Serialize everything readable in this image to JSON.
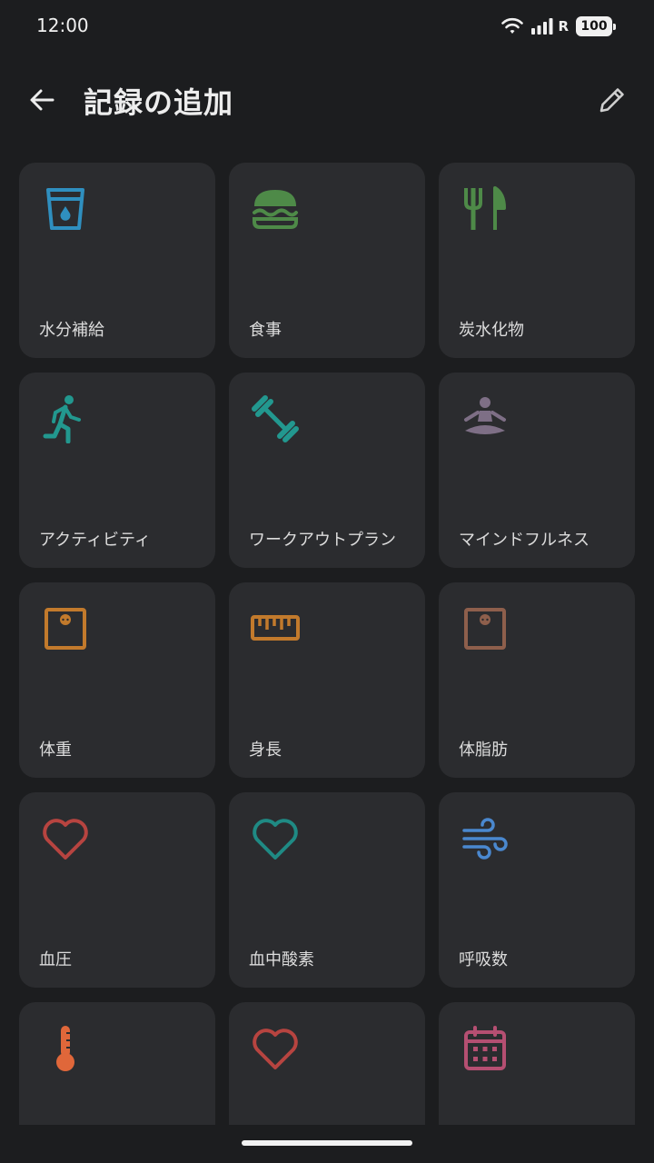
{
  "status_bar": {
    "time": "12:00",
    "network_label": "R",
    "battery": "100"
  },
  "app_bar": {
    "title": "記録の追加",
    "back_icon": "arrow-back-icon",
    "edit_icon": "pencil-icon"
  },
  "colors": {
    "background": "#1c1d1f",
    "card": "#2b2c2f",
    "water": "#2f8fbf",
    "food": "#4e8a48",
    "activity": "#22988f",
    "mindfulness": "#7e6f86",
    "body": "#c27a2c",
    "body_fat": "#8e5f4c",
    "heart": "#b74440",
    "spo2": "#1f8a84",
    "breath": "#4a88cf",
    "temperature": "#e0673a",
    "calendar": "#b54f72"
  },
  "cards": [
    {
      "label": "水分補給",
      "icon": "water-glass-icon"
    },
    {
      "label": "食事",
      "icon": "burger-icon"
    },
    {
      "label": "炭水化物",
      "icon": "fork-knife-icon"
    },
    {
      "label": "アクティビティ",
      "icon": "running-person-icon"
    },
    {
      "label": "ワークアウトプラン",
      "icon": "dumbbell-icon"
    },
    {
      "label": "マインドフルネス",
      "icon": "meditation-icon"
    },
    {
      "label": "体重",
      "icon": "scale-icon"
    },
    {
      "label": "身長",
      "icon": "ruler-icon"
    },
    {
      "label": "体脂肪",
      "icon": "body-fat-scale-icon"
    },
    {
      "label": "血圧",
      "icon": "heart-icon"
    },
    {
      "label": "血中酸素",
      "icon": "heart-icon"
    },
    {
      "label": "呼吸数",
      "icon": "wind-icon"
    },
    {
      "label": "",
      "icon": "thermometer-icon"
    },
    {
      "label": "",
      "icon": "heart-icon"
    },
    {
      "label": "",
      "icon": "calendar-icon"
    }
  ]
}
